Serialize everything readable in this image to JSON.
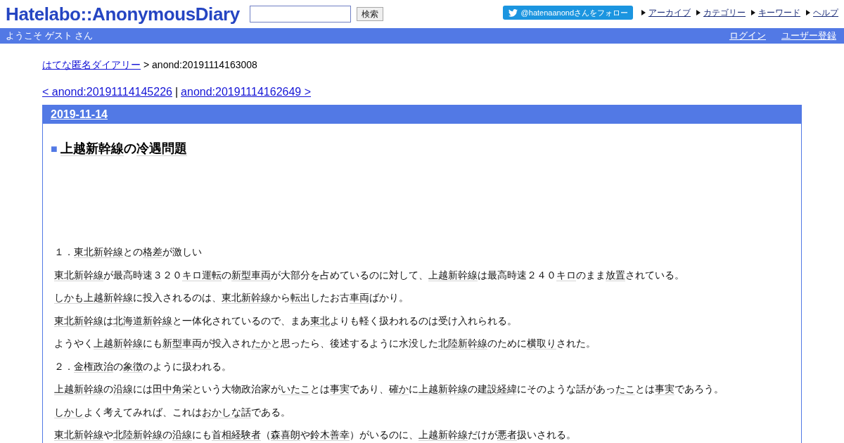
{
  "header": {
    "logo": "Hatelabo::AnonymousDiary",
    "search": {
      "button": "検索"
    },
    "follow_button": "@hatenaanondさんをフォロー",
    "links": [
      "アーカイブ",
      "カテゴリー",
      "キーワード",
      "ヘルプ"
    ]
  },
  "user_bar": {
    "greeting": "ようこそ ゲスト さん",
    "links": [
      "ログイン",
      "ユーザー登録"
    ]
  },
  "breadcrumb": {
    "link": "はてな匿名ダイアリー",
    "current": "> anond:20191114163008"
  },
  "pager": {
    "prev": "< anond:20191114145226",
    "separator": "|",
    "next": "anond:20191114162649 >"
  },
  "day": {
    "date": "2019-11-14",
    "entry": {
      "marker": "■",
      "title": [
        {
          "kind": "keyword",
          "text": "上越新幹線"
        },
        {
          "kind": "plain",
          "text": "の"
        },
        {
          "kind": "keyword",
          "text": "冷遇問題"
        }
      ],
      "paragraphs": [
        [
          {
            "kind": "plain",
            "text": "１．"
          },
          {
            "kind": "keyword",
            "text": "東北新幹線"
          },
          {
            "kind": "plain",
            "text": "との"
          },
          {
            "kind": "keyword",
            "text": "格差"
          },
          {
            "kind": "plain",
            "text": "が激しい"
          }
        ],
        [
          {
            "kind": "keyword",
            "text": "東北新幹線"
          },
          {
            "kind": "plain",
            "text": "が最高時速３２０"
          },
          {
            "kind": "keyword",
            "text": "キロ運転"
          },
          {
            "kind": "plain",
            "text": "の"
          },
          {
            "kind": "keyword",
            "text": "新型"
          },
          {
            "kind": "keyword",
            "text": "車両"
          },
          {
            "kind": "plain",
            "text": "が大部分を占めているのに対して、"
          },
          {
            "kind": "keyword",
            "text": "上越新幹線"
          },
          {
            "kind": "plain",
            "text": "は最高時速２４０"
          },
          {
            "kind": "keyword",
            "text": "キロ"
          },
          {
            "kind": "plain",
            "text": "のまま"
          },
          {
            "kind": "keyword",
            "text": "放置"
          },
          {
            "kind": "plain",
            "text": "されている。"
          }
        ],
        [
          {
            "kind": "keyword",
            "text": "しかも"
          },
          {
            "kind": "keyword",
            "text": "上越新幹線"
          },
          {
            "kind": "plain",
            "text": "に投入されるのは、"
          },
          {
            "kind": "keyword",
            "text": "東北新幹線"
          },
          {
            "kind": "plain",
            "text": "から"
          },
          {
            "kind": "keyword",
            "text": "転出"
          },
          {
            "kind": "plain",
            "text": "したお古"
          },
          {
            "kind": "keyword",
            "text": "車両"
          },
          {
            "kind": "plain",
            "text": "ばかり。"
          }
        ],
        [
          {
            "kind": "keyword",
            "text": "東北新幹線"
          },
          {
            "kind": "plain",
            "text": "は"
          },
          {
            "kind": "keyword",
            "text": "北海道新幹線"
          },
          {
            "kind": "plain",
            "text": "と一体化されているので、まあ"
          },
          {
            "kind": "keyword",
            "text": "東北"
          },
          {
            "kind": "plain",
            "text": "よりも軽く扱われるのは受け入れられる。"
          }
        ],
        [
          {
            "kind": "plain",
            "text": "ようやく"
          },
          {
            "kind": "keyword",
            "text": "上越新幹線"
          },
          {
            "kind": "plain",
            "text": "にも"
          },
          {
            "kind": "keyword",
            "text": "新型"
          },
          {
            "kind": "keyword",
            "text": "車両"
          },
          {
            "kind": "plain",
            "text": "が投入され"
          },
          {
            "kind": "keyword",
            "text": "たか"
          },
          {
            "kind": "plain",
            "text": "と思ったら、後述するように水没した"
          },
          {
            "kind": "keyword",
            "text": "北陸新幹線"
          },
          {
            "kind": "plain",
            "text": "のために"
          },
          {
            "kind": "keyword",
            "text": "横取り"
          },
          {
            "kind": "plain",
            "text": "された。"
          }
        ],
        [
          {
            "kind": "plain",
            "text": "２．"
          },
          {
            "kind": "keyword",
            "text": "金権政治"
          },
          {
            "kind": "plain",
            "text": "の"
          },
          {
            "kind": "keyword",
            "text": "象徴"
          },
          {
            "kind": "plain",
            "text": "のように扱われる。"
          }
        ],
        [
          {
            "kind": "keyword",
            "text": "上越新幹線"
          },
          {
            "kind": "plain",
            "text": "の"
          },
          {
            "kind": "keyword",
            "text": "沿線"
          },
          {
            "kind": "plain",
            "text": "には"
          },
          {
            "kind": "keyword",
            "text": "田中角栄"
          },
          {
            "kind": "plain",
            "text": "という大物政治家が"
          },
          {
            "kind": "keyword",
            "text": "いたこ"
          },
          {
            "kind": "plain",
            "text": "とは"
          },
          {
            "kind": "keyword",
            "text": "事実"
          },
          {
            "kind": "plain",
            "text": "であり、"
          },
          {
            "kind": "keyword",
            "text": "確か"
          },
          {
            "kind": "plain",
            "text": "に"
          },
          {
            "kind": "keyword",
            "text": "上越新幹線"
          },
          {
            "kind": "plain",
            "text": "の"
          },
          {
            "kind": "keyword",
            "text": "建設"
          },
          {
            "kind": "keyword",
            "text": "経緯"
          },
          {
            "kind": "plain",
            "text": "にそのような話があっ"
          },
          {
            "kind": "keyword",
            "text": "たこ"
          },
          {
            "kind": "plain",
            "text": "とは"
          },
          {
            "kind": "keyword",
            "text": "事実"
          },
          {
            "kind": "plain",
            "text": "であろう。"
          }
        ],
        [
          {
            "kind": "keyword",
            "text": "しかし"
          },
          {
            "kind": "plain",
            "text": "よく考えてみれば、これは"
          },
          {
            "kind": "keyword",
            "text": "おかしな話"
          },
          {
            "kind": "plain",
            "text": "である。"
          }
        ],
        [
          {
            "kind": "keyword",
            "text": "東北新幹線"
          },
          {
            "kind": "plain",
            "text": "や"
          },
          {
            "kind": "keyword",
            "text": "北陸新幹線"
          },
          {
            "kind": "plain",
            "text": "の"
          },
          {
            "kind": "keyword",
            "text": "沿線"
          },
          {
            "kind": "plain",
            "text": "にも"
          },
          {
            "kind": "keyword",
            "text": "首相"
          },
          {
            "kind": "keyword",
            "text": "経験者"
          },
          {
            "kind": "plain",
            "text": "（"
          },
          {
            "kind": "keyword",
            "text": "森喜朗"
          },
          {
            "kind": "plain",
            "text": "や"
          },
          {
            "kind": "keyword",
            "text": "鈴木善幸"
          },
          {
            "kind": "plain",
            "text": "）がいるのに、"
          },
          {
            "kind": "keyword",
            "text": "上越新幹線"
          },
          {
            "kind": "plain",
            "text": "だけが"
          },
          {
            "kind": "keyword",
            "text": "悪者"
          },
          {
            "kind": "plain",
            "text": "扱いされる。"
          }
        ]
      ]
    }
  }
}
